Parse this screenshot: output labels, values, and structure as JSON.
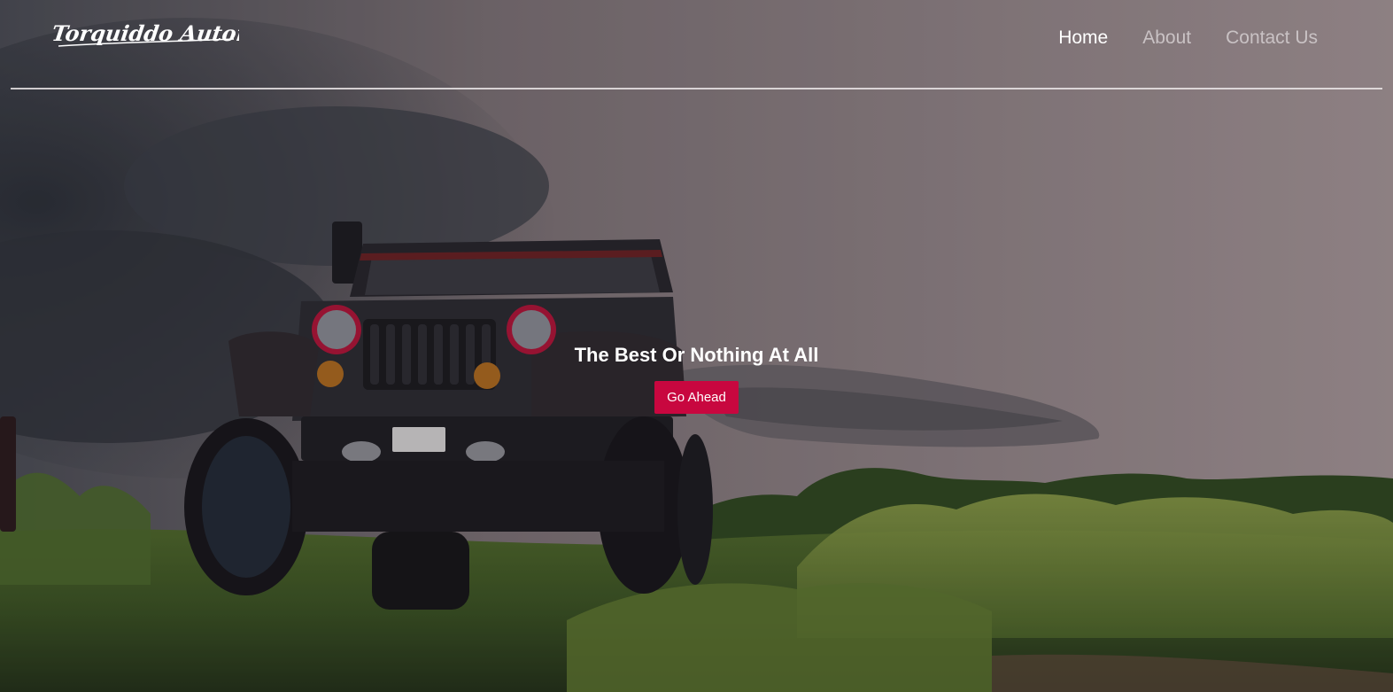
{
  "brand": {
    "logo_text": "Torquiddo Automotive"
  },
  "nav": {
    "items": [
      {
        "label": "Home",
        "active": true
      },
      {
        "label": "About",
        "active": false
      },
      {
        "label": "Contact Us",
        "active": false
      }
    ]
  },
  "hero": {
    "tagline": "The Best Or Nothing At All",
    "cta_label": "Go Ahead",
    "background_image": "off-road-jeep-on-grass-under-stormy-sky"
  },
  "colors": {
    "cta_background": "#c8073f",
    "nav_active": "#ffffff",
    "nav_inactive": "#c9c2c4",
    "divider": "#ebe6e8"
  }
}
